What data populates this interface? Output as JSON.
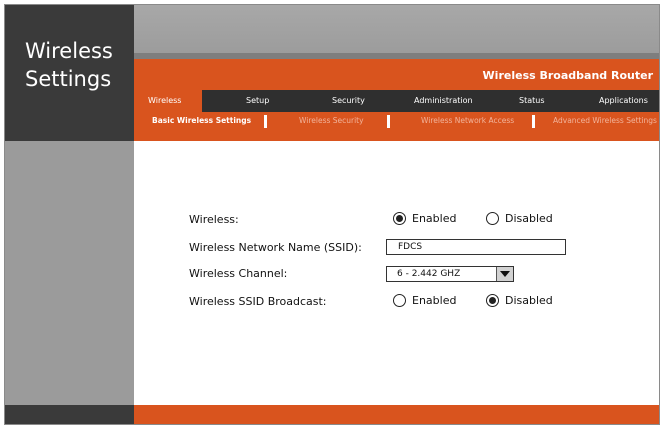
{
  "page": {
    "title_line1": "Wireless",
    "title_line2": "Settings"
  },
  "brand": {
    "title": "Wireless Broadband Router"
  },
  "nav": {
    "items": [
      {
        "label": "Wireless",
        "active": true
      },
      {
        "label": "Setup"
      },
      {
        "label": "Security"
      },
      {
        "label": "Administration"
      },
      {
        "label": "Status"
      },
      {
        "label": "Applications"
      }
    ]
  },
  "subnav": {
    "items": [
      {
        "label": "Basic Wireless Settings",
        "active": true
      },
      {
        "label": "Wireless Security"
      },
      {
        "label": "Wireless Network Access"
      },
      {
        "label": "Advanced Wireless Settings"
      }
    ]
  },
  "form": {
    "wireless": {
      "label": "Wireless:",
      "option_enabled": "Enabled",
      "option_disabled": "Disabled",
      "selected": "Enabled"
    },
    "ssid": {
      "label": "Wireless Network Name (SSID):",
      "value": "FDCS"
    },
    "channel": {
      "label": "Wireless Channel:",
      "value": "6 - 2.442 GHZ"
    },
    "broadcast": {
      "label": "Wireless SSID Broadcast:",
      "option_enabled": "Enabled",
      "option_disabled": "Disabled",
      "selected": "Disabled"
    }
  },
  "colors": {
    "accent": "#d9541e",
    "dark": "#3a3a3a",
    "nav_bg": "#2f2f2f",
    "side_gray": "#9b9b9b"
  },
  "icons": {
    "channel_dropdown": "chevron-down-icon"
  }
}
